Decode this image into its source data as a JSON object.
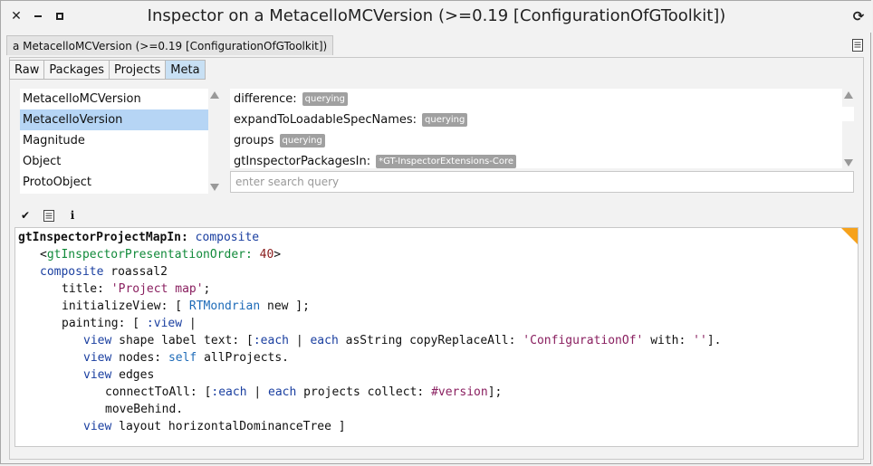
{
  "window": {
    "title": "Inspector on a MetacelloMCVersion (>=0.19 [ConfigurationOfGToolkit])",
    "object_tab": "a MetacelloMCVersion (>=0.19 [ConfigurationOfGToolkit])"
  },
  "tabs": [
    "Raw",
    "Packages",
    "Projects",
    "Meta"
  ],
  "active_tab": "Meta",
  "classes": [
    "MetacelloMCVersion",
    "MetacelloVersion",
    "Magnitude",
    "Object",
    "ProtoObject"
  ],
  "selected_class": "MetacelloVersion",
  "methods": [
    {
      "name": "difference:",
      "tag": "querying"
    },
    {
      "name": "expandToLoadableSpecNames:",
      "tag": "querying"
    },
    {
      "name": "groups",
      "tag": "querying"
    },
    {
      "name": "gtInspectorPackagesIn:",
      "tag": "*GT-InspectorExtensions-Core"
    }
  ],
  "search": {
    "placeholder": "enter search query"
  },
  "toolbar": {
    "accept": "✔",
    "info": "i"
  },
  "code": {
    "l1_sel": "gtInspectorProjectMapIn:",
    "l1_arg": "composite",
    "l2_open": "<",
    "l2_pragma": "gtInspectorPresentationOrder:",
    "l2_num": "40",
    "l2_close": ">",
    "l3_a": "composite",
    "l3_b": "roassal2",
    "l4_a": "title:",
    "l4_str": "'Project map'",
    "l4_end": ";",
    "l5_a": "initializeView: [",
    "l5_cls": "RTMondrian",
    "l5_b": "new ];",
    "l6_a": "painting: [",
    "l6_arg": ":view",
    "l6_b": "|",
    "l7_view": "view",
    "l7_a": "shape label text: [",
    "l7_each": ":each",
    "l7_b": "|",
    "l7_each2": "each",
    "l7_c": "asString copyReplaceAll:",
    "l7_str": "'ConfigurationOf'",
    "l7_d": "with:",
    "l7_str2": "''",
    "l7_e": "].",
    "l8_view": "view",
    "l8_a": "nodes:",
    "l8_self": "self",
    "l8_b": "allProjects.",
    "l9_view": "view",
    "l9_a": "edges",
    "l10_a": "connectToAll: [",
    "l10_each": ":each",
    "l10_b": "|",
    "l10_each2": "each",
    "l10_c": "projects collect:",
    "l10_sym": "#version",
    "l10_d": "];",
    "l11_a": "moveBehind.",
    "l12_view": "view",
    "l12_a": "layout horizontalDominanceTree ]"
  },
  "colors": {
    "accent_selected": "#b6d5f5",
    "corner": "#f6a21c",
    "badge": "#a0a0a0"
  }
}
